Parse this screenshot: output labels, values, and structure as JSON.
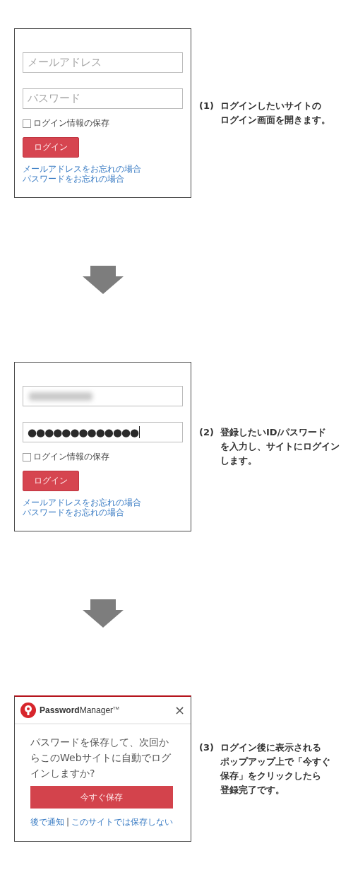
{
  "steps": [
    {
      "kind": "login",
      "number": "(1)",
      "caption": [
        "ログインしたいサイトの",
        "ログイン画面を開きます。"
      ],
      "email": {
        "placeholder": "メールアドレス"
      },
      "password": {
        "placeholder": "パスワード"
      },
      "remember": {
        "label": "ログイン情報の保存",
        "checked": false
      },
      "button": "ログイン",
      "links": [
        "メールアドレスをお忘れの場合",
        "パスワードをお忘れの場合"
      ]
    },
    {
      "kind": "login",
      "number": "(2)",
      "caption": [
        "登録したいID/パスワード",
        "を入力し、サイトにログイン",
        "します。"
      ],
      "email": {
        "redacted": true
      },
      "password": {
        "value": "●●●●●●●●●●●●●"
      },
      "remember": {
        "label": "ログイン情報の保存",
        "checked": false
      },
      "button": "ログイン",
      "links": [
        "メールアドレスをお忘れの場合",
        "パスワードをお忘れの場合"
      ]
    },
    {
      "kind": "popup",
      "number": "(3)",
      "caption": [
        "ログイン後に表示される",
        "ポップアップ上で「今すぐ",
        "保存」をクリックしたら",
        "登録完了です。"
      ],
      "brand": "**Password**Manager$^{TM}$",
      "close": "×",
      "message": "パスワードを保存して、次回からこのWebサイトに自動でログインしますか?",
      "button": "今すぐ保存",
      "links": [
        "後で通知",
        "このサイトでは保存しない"
      ],
      "separator": "|"
    }
  ]
}
